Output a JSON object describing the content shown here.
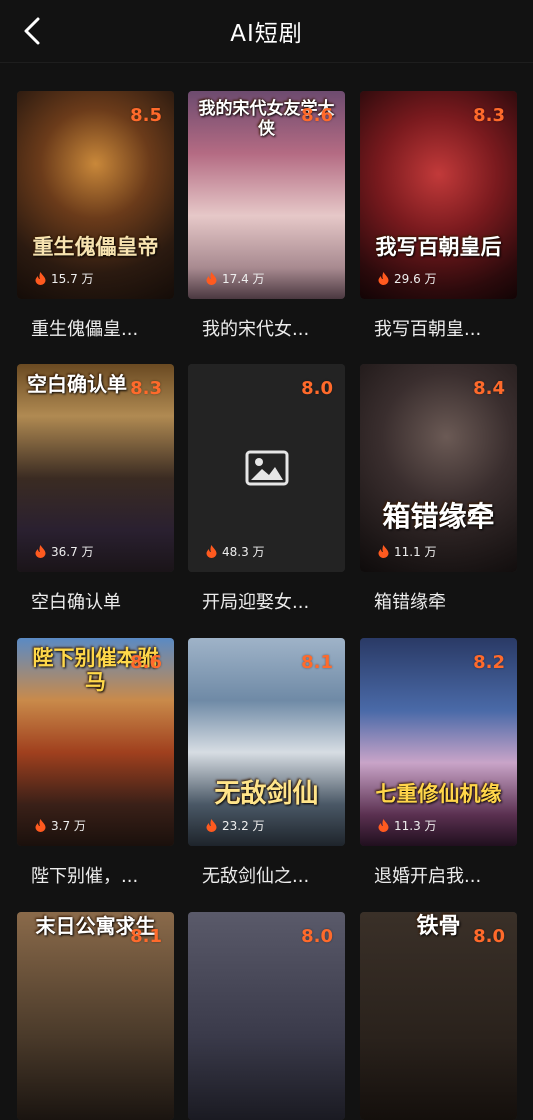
{
  "header": {
    "title": "AI短剧"
  },
  "cards": [
    {
      "title": "重生傀儡皇...",
      "rating": "8.5",
      "views": "15.7 万",
      "poster_text": "重生傀儡皇帝"
    },
    {
      "title": "我的宋代女...",
      "rating": "8.6",
      "views": "17.4 万",
      "poster_text": "我的宋代女友学大侠"
    },
    {
      "title": "我写百朝皇...",
      "rating": "8.3",
      "views": "29.6 万",
      "poster_text": "我写百朝皇后"
    },
    {
      "title": "空白确认单",
      "rating": "8.3",
      "views": "36.7 万",
      "poster_text": "空白确认单"
    },
    {
      "title": "开局迎娶女...",
      "rating": "8.0",
      "views": "48.3 万",
      "poster_text": ""
    },
    {
      "title": "箱错缘牵",
      "rating": "8.4",
      "views": "11.1 万",
      "poster_text": "箱错缘牵"
    },
    {
      "title": "陛下别催，...",
      "rating": "8.6",
      "views": "3.7 万",
      "poster_text": "陛下别催本驸马"
    },
    {
      "title": "无敌剑仙之...",
      "rating": "8.1",
      "views": "23.2 万",
      "poster_text": "无敌剑仙"
    },
    {
      "title": "退婚开启我...",
      "rating": "8.2",
      "views": "11.3 万",
      "poster_text": "七重修仙机缘"
    },
    {
      "title": "",
      "rating": "8.1",
      "views": "",
      "poster_text": "末日公寓求生"
    },
    {
      "title": "",
      "rating": "8.0",
      "views": "",
      "poster_text": ""
    },
    {
      "title": "",
      "rating": "8.0",
      "views": "",
      "poster_text": "铁骨"
    }
  ],
  "icons": {
    "back": "chevron-left-icon",
    "views": "fire-icon",
    "placeholder": "image-placeholder-icon"
  },
  "colors": {
    "background": "#121212",
    "rating": "#ff6a2b",
    "fire": "#ff5a1f"
  }
}
